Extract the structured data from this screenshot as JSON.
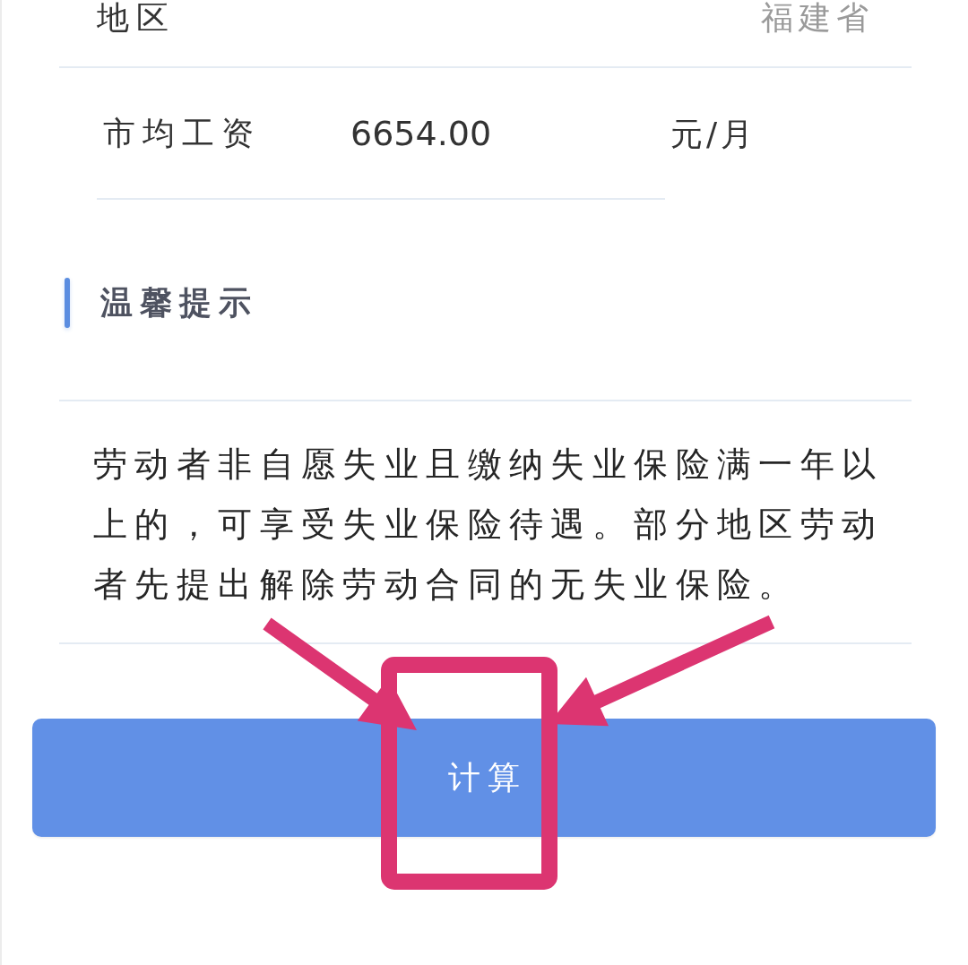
{
  "rows": [
    {
      "kind": "picker",
      "label": "地区",
      "value": "福建省"
    },
    {
      "kind": "amount",
      "label": "市均工资",
      "value": "6654.00",
      "unit": "元/月"
    }
  ],
  "notice": {
    "title": "温馨提示",
    "text": "劳动者非自愿失业且缴纳失业保险满一年以上的，可享受失业保险待遇。部分地区劳动者先提出解除劳动合同的无失业保险。"
  },
  "button": {
    "label": "计算"
  },
  "annotations": [
    {
      "kind": "arrow"
    },
    {
      "kind": "arrow"
    },
    {
      "kind": "frame"
    }
  ]
}
